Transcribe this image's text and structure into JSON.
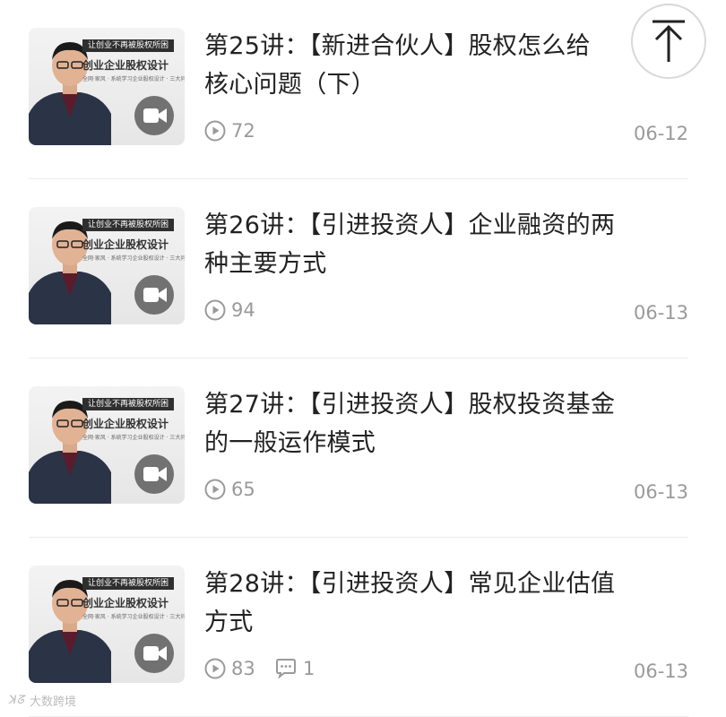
{
  "lectures": [
    {
      "title": "第25讲：【新进合伙人】股权怎么给核心问题（下）",
      "title_line1": "第25讲：【新进合伙人】股权怎么给",
      "title_line2": "核心问题（下）",
      "views": "72",
      "comments": "",
      "date": "06-12"
    },
    {
      "title": "第26讲：【引进投资人】企业融资的两种主要方式",
      "title_line1": "第26讲：【引进投资人】企业融资的两",
      "title_line2": "种主要方式",
      "views": "94",
      "comments": "",
      "date": "06-13"
    },
    {
      "title": "第27讲：【引进投资人】股权投资基金的一般运作模式",
      "title_line1": "第27讲：【引进投资人】股权投资基金",
      "title_line2": "的一般运作模式",
      "views": "65",
      "comments": "",
      "date": "06-13"
    },
    {
      "title": "第28讲：【引进投资人】常见企业估值方式",
      "title_line1": "第28讲：【引进投资人】常见企业估值",
      "title_line2": "方式",
      "views": "83",
      "comments": "1",
      "date": "06-13"
    }
  ],
  "thumbnail": {
    "tag": "让创业不再被股权所困",
    "title": "创业企业股权设计",
    "subtitle": "全网·家风 · 系统学习企业股权设计 · 三大问题",
    "speaker": "主讲人："
  },
  "scroll_top": {
    "icon": "arrow-up-icon"
  },
  "watermark": {
    "text": "大数跨境",
    "mark": "ꓘᘔ"
  },
  "colors": {
    "text": "#222222",
    "meta": "#9a9a9a",
    "divider": "#ececec"
  }
}
